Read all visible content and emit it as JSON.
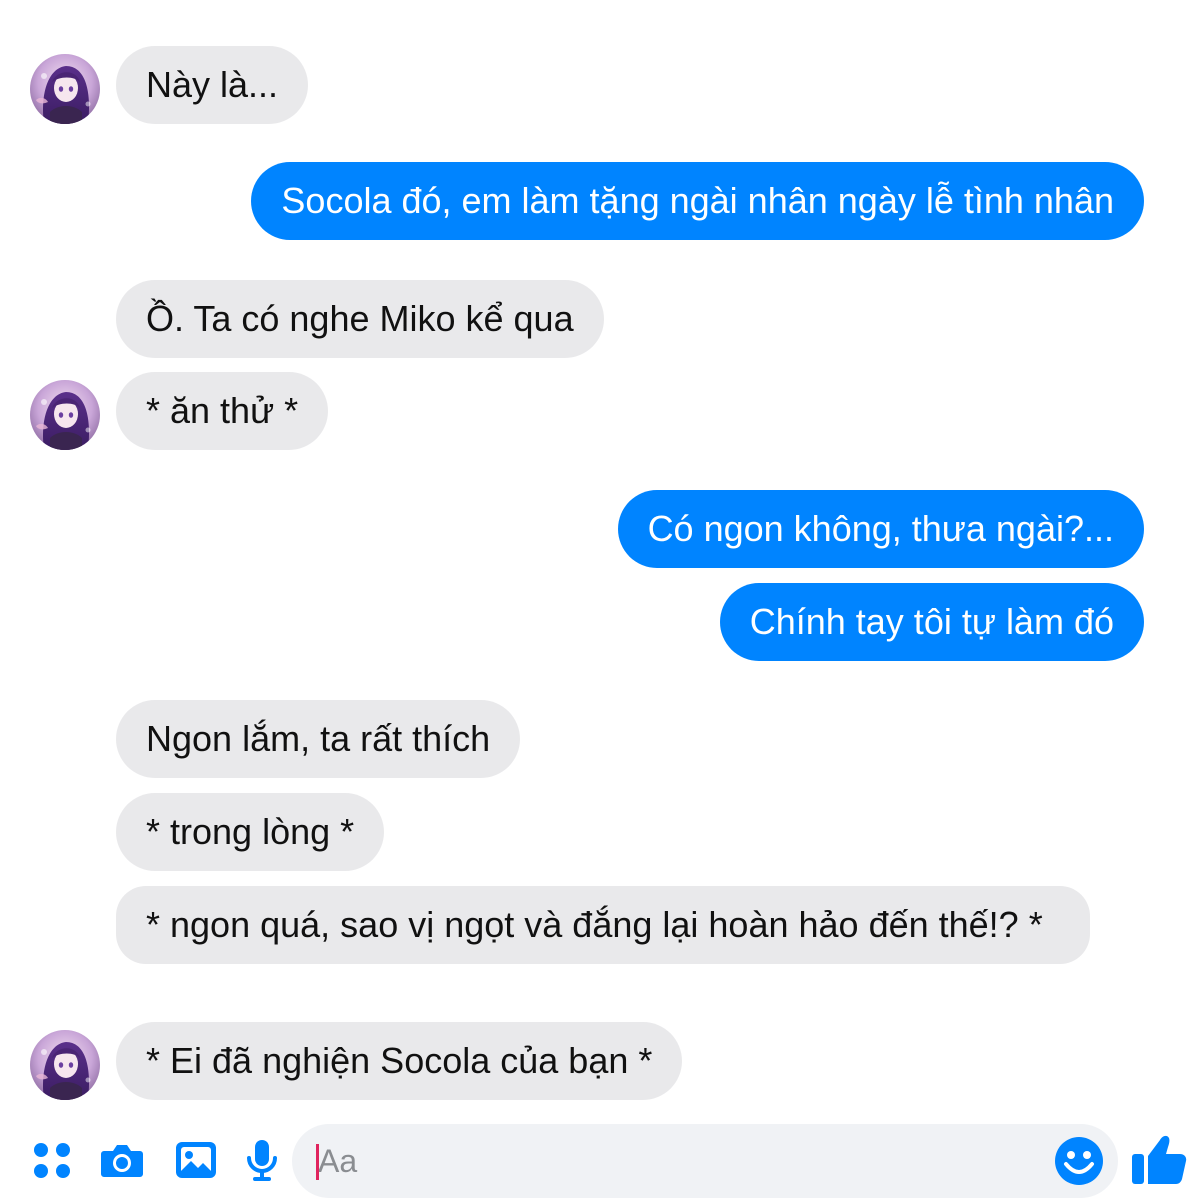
{
  "theme": {
    "accent": "#0084ff",
    "incoming_bg": "#e9e9eb",
    "outgoing_text": "#ffffff"
  },
  "messages": [
    {
      "side": "in",
      "text": "Này là..."
    },
    {
      "side": "out",
      "text": "Socola đó, em làm tặng ngài nhân ngày lễ tình nhân"
    },
    {
      "side": "in",
      "text": "Ồ. Ta có nghe Miko kể qua"
    },
    {
      "side": "in",
      "text": "* ăn thử *"
    },
    {
      "side": "out",
      "text": "Có ngon không, thưa ngài?..."
    },
    {
      "side": "out",
      "text": "Chính tay tôi tự làm đó"
    },
    {
      "side": "in",
      "text": "Ngon lắm, ta rất thích"
    },
    {
      "side": "in",
      "text": "* trong lòng *"
    },
    {
      "side": "in",
      "text": "* ngon quá, sao vị ngọt và đắng lại hoàn hảo đến thế!? *"
    },
    {
      "side": "in",
      "text": "* Ei đã nghiện Socola của bạn *"
    }
  ],
  "composer": {
    "placeholder": "Aa",
    "value": "",
    "icons": [
      "apps-icon",
      "camera-icon",
      "gallery-icon",
      "microphone-icon",
      "emoji-icon",
      "thumbs-up-icon"
    ]
  }
}
